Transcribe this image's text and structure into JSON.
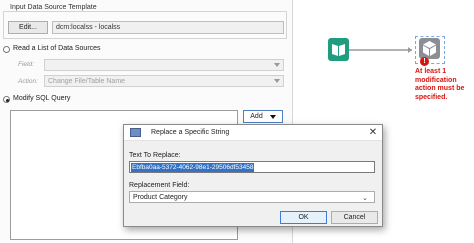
{
  "config": {
    "template_group_title": "Input Data Source Template",
    "edit_label": "Edit...",
    "connection_value": "dcm:localss - localss",
    "radio_list_label": "Read a List of Data Sources",
    "field_label": "Field:",
    "action_label": "Action:",
    "action_value": "Change File/Table Name",
    "radio_sql_label": "Modify SQL Query",
    "add_label": "Add"
  },
  "canvas": {
    "error_text": "At least 1 modification action must be specified."
  },
  "dialog": {
    "title": "Replace a Specific String",
    "text_to_replace_label": "Text To Replace:",
    "text_to_replace_value": "Ebfba0aa-5372-4062-98e1-29506df53458",
    "replacement_field_label": "Replacement Field:",
    "replacement_field_value": "Product Category",
    "ok_label": "OK",
    "cancel_label": "Cancel"
  },
  "colors": {
    "selection": "#3372c4",
    "error": "#d8150f",
    "tool_green": "#1f9d7f",
    "tool_gray": "#8b8f93",
    "connector": "#9a9a9a"
  }
}
